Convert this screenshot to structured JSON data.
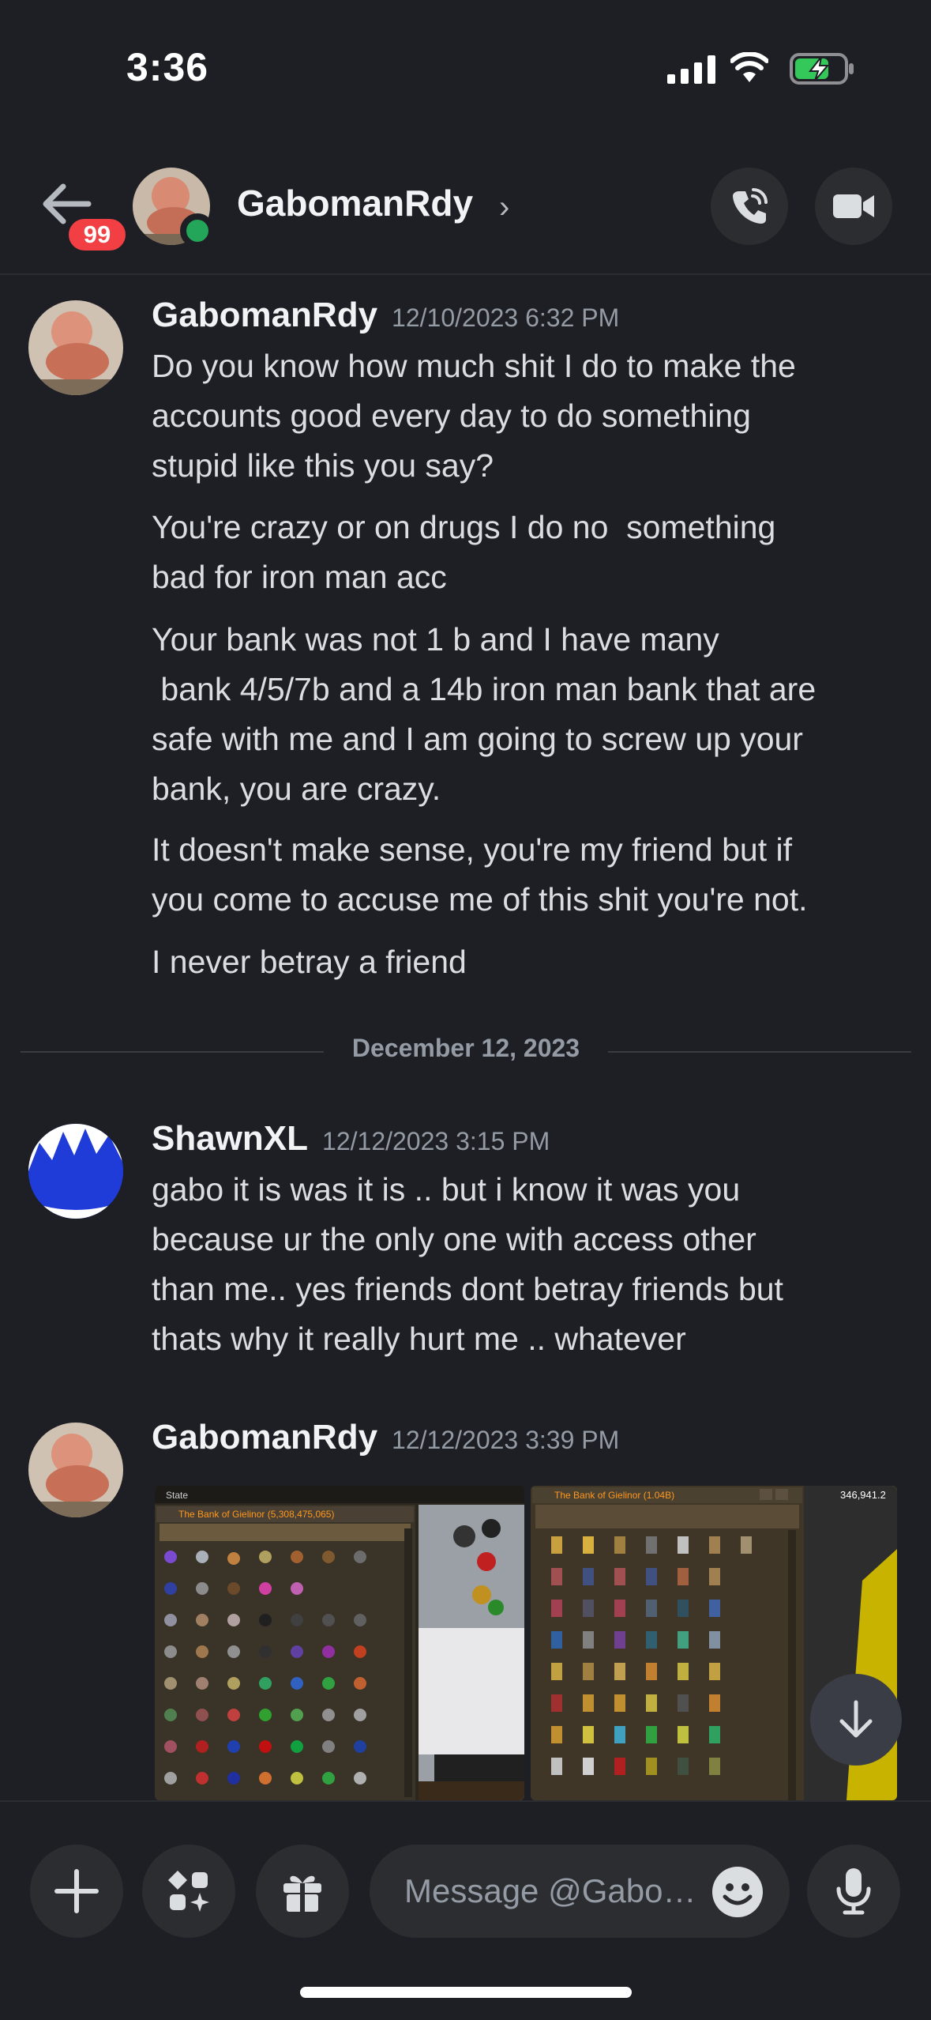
{
  "status_bar": {
    "time": "3:36"
  },
  "header": {
    "unread_badge": "99",
    "name": "GabomanRdy",
    "chevron": "›",
    "icons": [
      "back-arrow-icon",
      "phone-call-icon",
      "video-camera-icon"
    ]
  },
  "messages": [
    {
      "author": "GabomanRdy",
      "timestamp": "12/10/2023 6:32 PM",
      "lines": [
        "Do you know how much shit I do to make the\naccounts good every day to do something\nstupid like this you say?",
        "You're crazy or on drugs I do no  something\nbad for iron man acc",
        "Your bank was not 1 b and I have many\n bank 4/5/7b and a 14b iron man bank that are\nsafe with me and I am going to screw up your\nbank, you are crazy.",
        "It doesn't make sense, you're my friend but if\nyou come to accuse me of this shit you're not.",
        "I never betray a friend"
      ]
    },
    {
      "author": "ShawnXL",
      "timestamp": "12/12/2023 3:15 PM",
      "lines": [
        "gabo it is was it is .. but i know it was you\nbecause ur the only one with access other\nthan me.. yes friends dont betray friends but\nthats why it really hurt me .. whatever"
      ]
    },
    {
      "author": "GabomanRdy",
      "timestamp": "12/12/2023 3:39 PM",
      "attachments": [
        {
          "title": "The Bank of Gielinor (5,308,475,065)",
          "top_label": "State"
        },
        {
          "title": "The Bank of Gielinor (1.04B)",
          "corner_value": "346,941.2"
        }
      ]
    }
  ],
  "date_divider": "December 12, 2023",
  "composer": {
    "placeholder": "Message @Gabo…"
  },
  "colors": {
    "background": "#1e1f25",
    "surface": "#2b2d31",
    "badge": "#f23f43",
    "online": "#23a55a",
    "muted": "#949ba4"
  }
}
